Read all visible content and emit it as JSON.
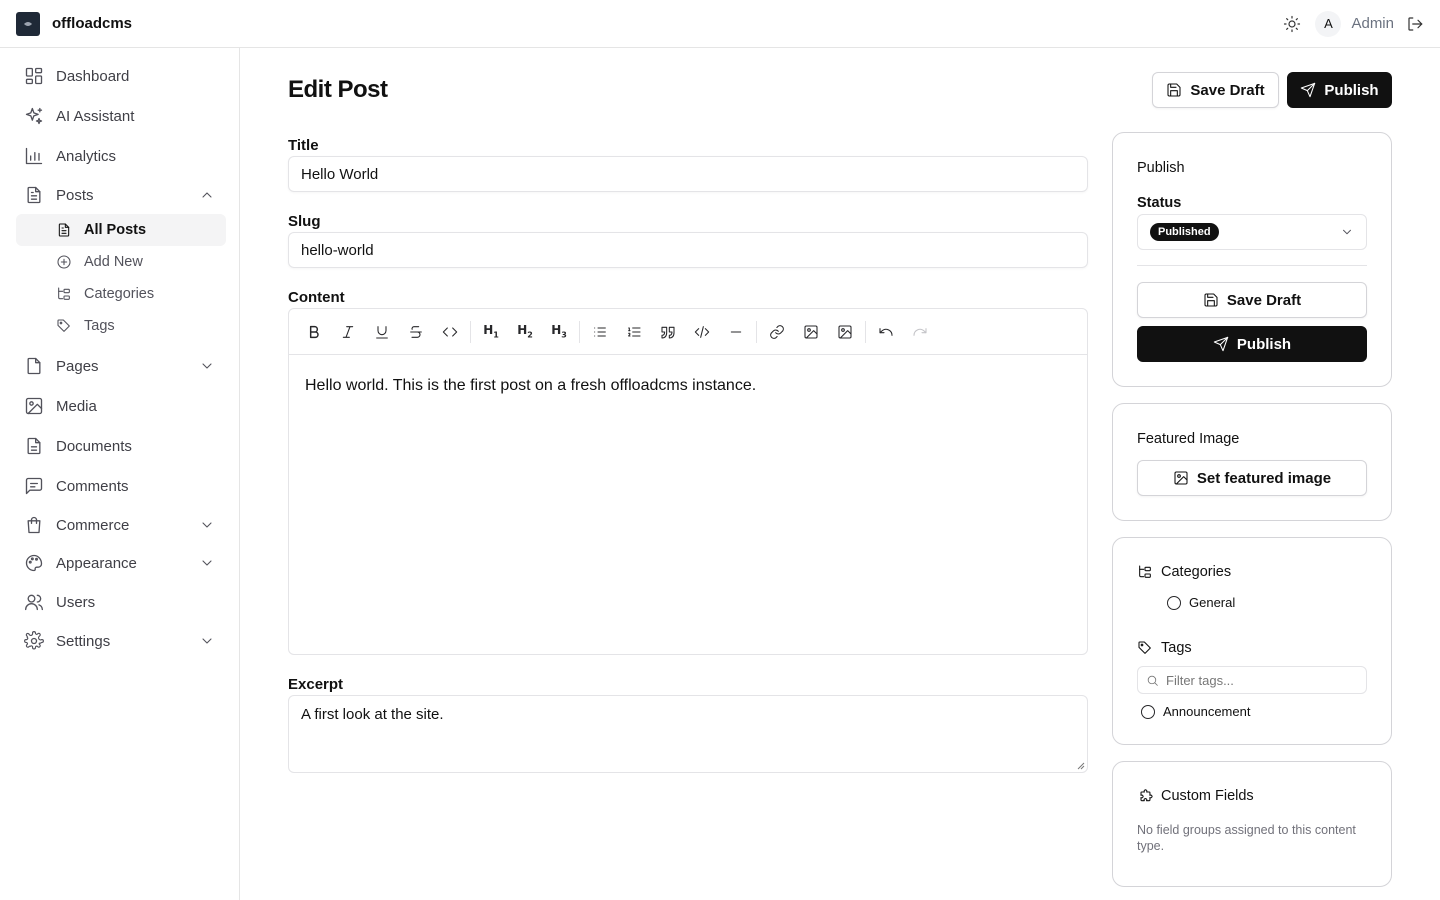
{
  "app": {
    "brand": "offloadcms"
  },
  "topbar": {
    "avatar_initial": "A",
    "user_name": "Admin"
  },
  "sidebar": {
    "items": [
      {
        "label": "Dashboard"
      },
      {
        "label": "AI Assistant"
      },
      {
        "label": "Analytics"
      },
      {
        "label": "Posts"
      },
      {
        "label": "Pages"
      },
      {
        "label": "Media"
      },
      {
        "label": "Documents"
      },
      {
        "label": "Comments"
      },
      {
        "label": "Commerce"
      },
      {
        "label": "Appearance"
      },
      {
        "label": "Users"
      },
      {
        "label": "Settings"
      }
    ],
    "posts_sub": [
      {
        "label": "All Posts"
      },
      {
        "label": "Add New"
      },
      {
        "label": "Categories"
      },
      {
        "label": "Tags"
      }
    ]
  },
  "main": {
    "title": "Edit Post",
    "save_draft": "Save Draft",
    "publish": "Publish",
    "title_label": "Title",
    "title_value": "Hello World",
    "slug_label": "Slug",
    "slug_value": "hello-world",
    "content_label": "Content",
    "content_text": "Hello world. This is the first post on a fresh offloadcms instance.",
    "excerpt_label": "Excerpt",
    "excerpt_value": "A first look at the site."
  },
  "publish_card": {
    "title": "Publish",
    "status_label": "Status",
    "status_value": "Published",
    "save_draft": "Save Draft",
    "publish": "Publish"
  },
  "featured_card": {
    "title": "Featured Image",
    "button": "Set featured image"
  },
  "taxonomy_card": {
    "categories_title": "Categories",
    "categories": [
      "General"
    ],
    "tags_title": "Tags",
    "tags_placeholder": "Filter tags...",
    "tags": [
      "Announcement"
    ]
  },
  "custom_fields_card": {
    "title": "Custom Fields",
    "message": "No field groups assigned to this content type."
  }
}
